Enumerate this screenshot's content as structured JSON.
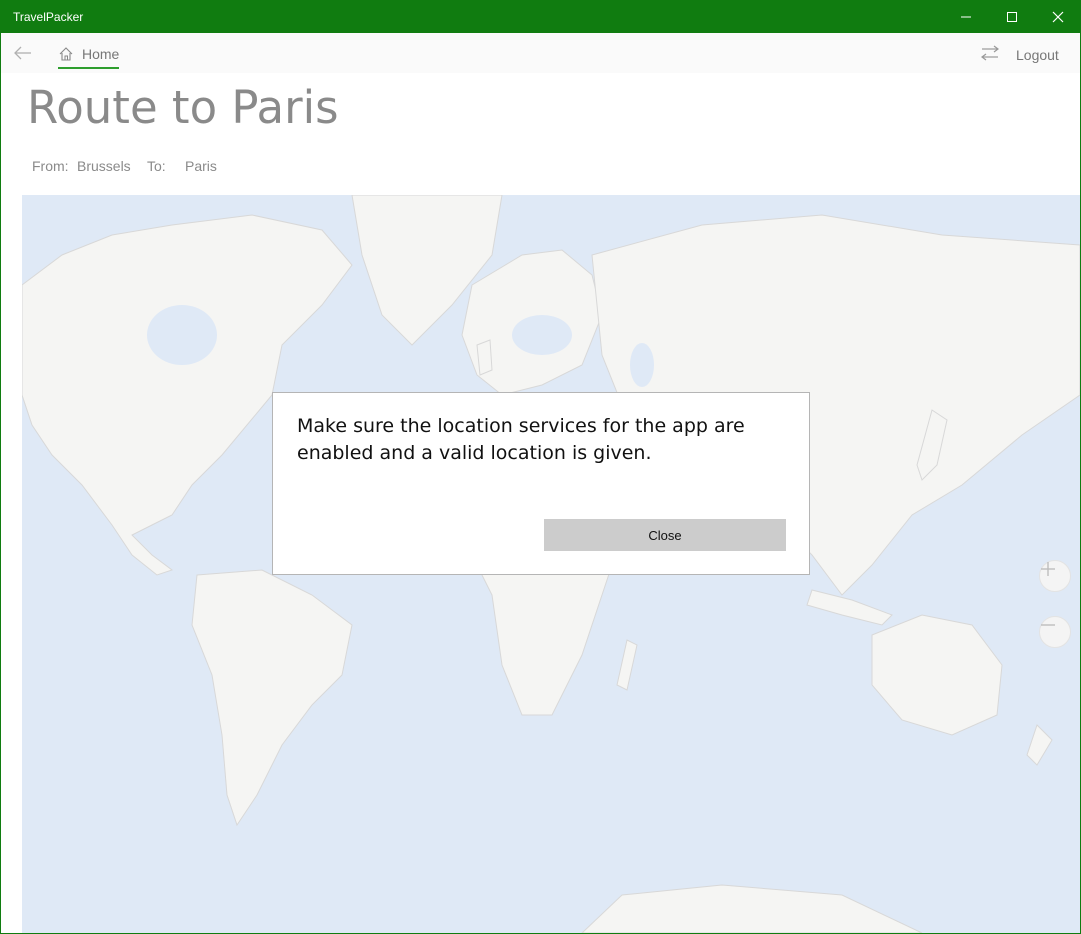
{
  "window": {
    "title": "TravelPacker",
    "accent_color": "#107c10"
  },
  "nav": {
    "back_icon": "back-arrow-icon",
    "home_label": "Home",
    "home_icon": "home-icon",
    "swap_icon": "swap-arrows-icon",
    "logout_label": "Logout"
  },
  "page": {
    "title": "Route to Paris",
    "from_label": "From:",
    "from_value": "Brussels",
    "to_label": "To:",
    "to_value": "Paris"
  },
  "map": {
    "water_color": "#dfe9f6",
    "land_color": "#f5f5f3",
    "zoom_in_icon": "plus-icon",
    "zoom_out_icon": "minus-icon"
  },
  "dialog": {
    "message": "Make sure the location services for the app are enabled and a valid location is given.",
    "close_label": "Close"
  }
}
